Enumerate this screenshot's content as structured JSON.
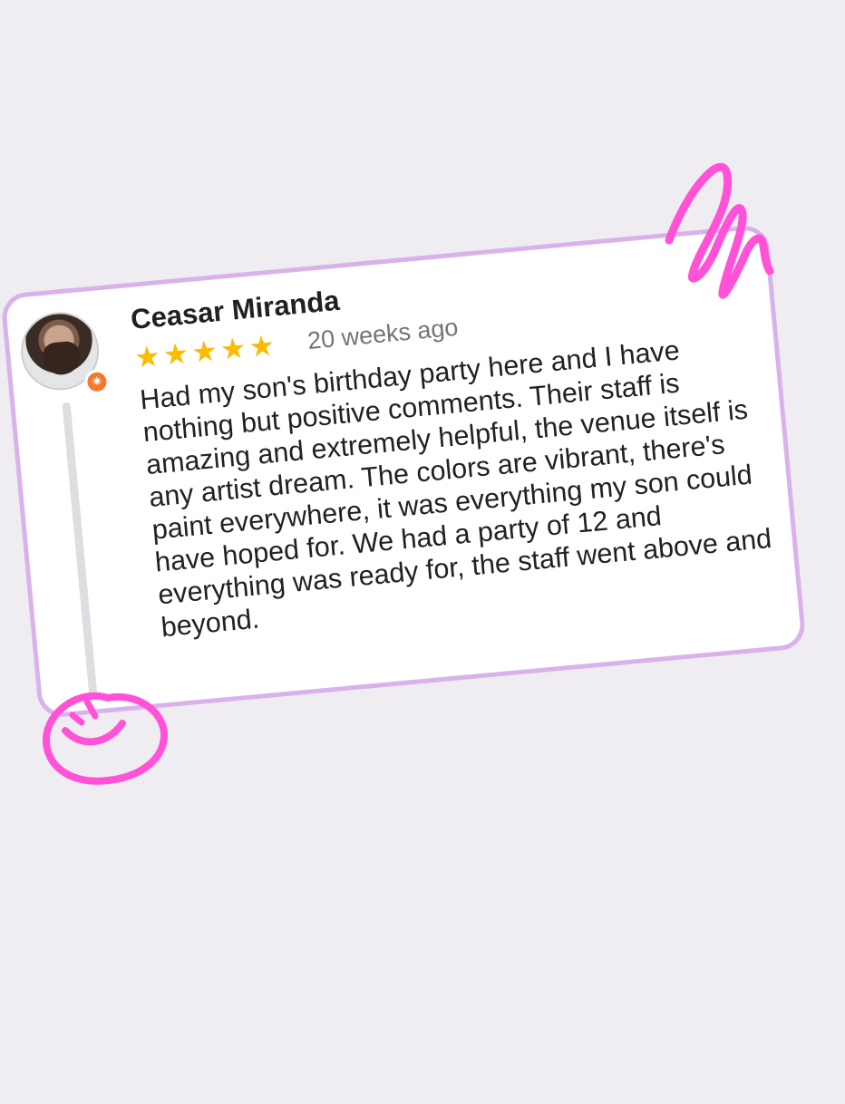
{
  "review": {
    "reviewer_name": "Ceasar Miranda",
    "rating": 5,
    "rating_max": 5,
    "stars": [
      "★",
      "★",
      "★",
      "★",
      "★"
    ],
    "time_ago": "20 weeks ago",
    "text": "Had my son's birthday party here and I have nothing but positive comments. Their staff is amazing and extremely helpful, the venue itself is any artist dream. The colors are vibrant, there's paint everywhere, it was everything my son could have hoped for. We had a party of 12 and everything was ready for, the staff went above and beyond.",
    "badge_icon": "local-guide-star-icon",
    "badge_glyph": "✷"
  },
  "colors": {
    "page_background": "#efedf1",
    "card_border": "#d9b2ec",
    "star": "#fbbc04",
    "doodle": "#ff52d7",
    "badge": "#f17a2c"
  }
}
